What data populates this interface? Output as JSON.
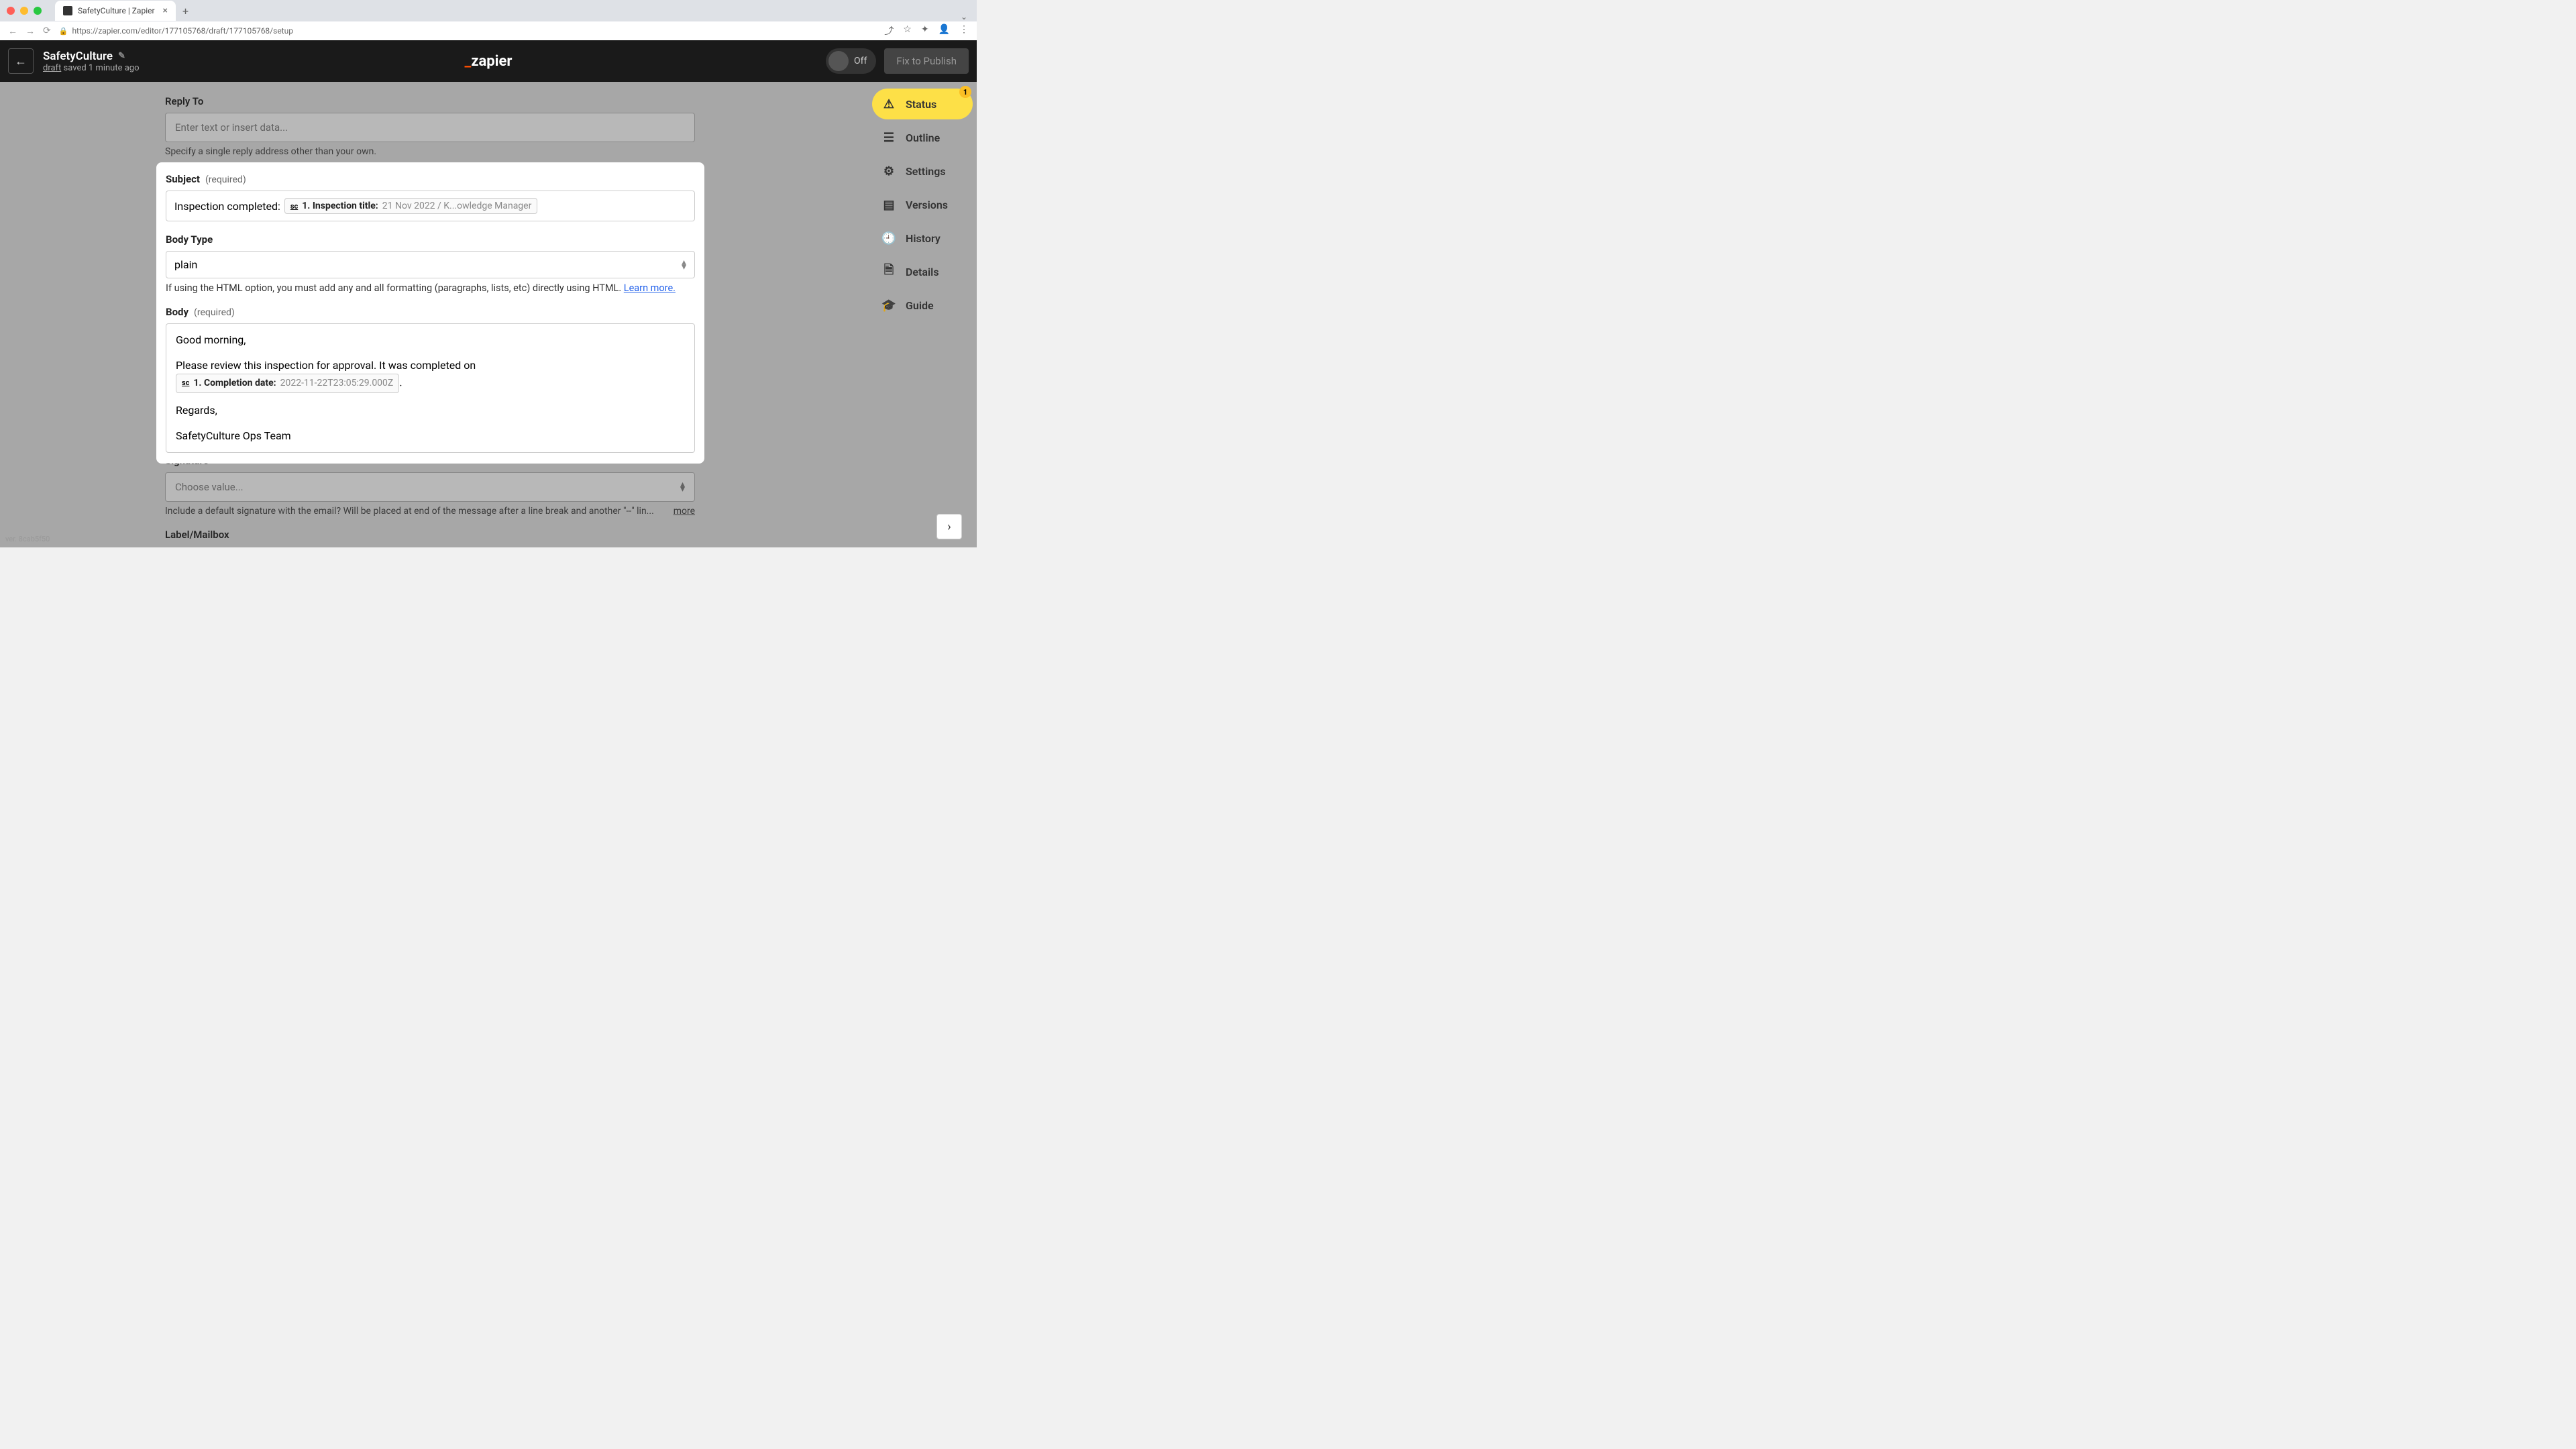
{
  "browser": {
    "tab_title": "SafetyCulture | Zapier",
    "url": "https://zapier.com/editor/177105768/draft/177105768/setup"
  },
  "header": {
    "title": "SafetyCulture",
    "draft_label": "draft",
    "saved_text": " saved 1 minute ago",
    "logo_accent": "_",
    "logo_text": "zapier",
    "toggle_label": "Off",
    "fix_button": "Fix to Publish"
  },
  "bg_form": {
    "reply_to_label": "Reply To",
    "reply_to_placeholder": "Enter text or insert data...",
    "reply_to_help": "Specify a single reply address other than your own.",
    "signature_label": "Signature",
    "signature_placeholder": "Choose value...",
    "signature_help": "Include a default signature with the email? Will be placed at end of the message after a line break and another \"--\" lin...",
    "signature_more": "more",
    "label_mailbox_label": "Label/Mailbox"
  },
  "rail": {
    "status": "Status",
    "status_badge": "1",
    "outline": "Outline",
    "settings": "Settings",
    "versions": "Versions",
    "history": "History",
    "details": "Details",
    "guide": "Guide"
  },
  "panel": {
    "subject_label": "Subject",
    "required": "(required)",
    "subject_prefix": "Inspection completed:",
    "subject_pill_label": "1. Inspection title:",
    "subject_pill_value": "21 Nov 2022 / K...owledge Manager",
    "body_type_label": "Body Type",
    "body_type_value": "plain",
    "body_type_help_text": "If using the HTML option, you must add any and all formatting (paragraphs, lists, etc) directly using HTML. ",
    "body_type_help_link": "Learn more.",
    "body_label": "Body",
    "body_line1": "Good morning,",
    "body_line2_pre": "Please review this inspection for approval. It was completed on ",
    "body_pill_label": "1. Completion date:",
    "body_pill_value": "2022-11-22T23:05:29.000Z",
    "body_line2_post": ".",
    "body_line3": "Regards,",
    "body_line4": "SafetyCulture Ops Team"
  },
  "footer": {
    "ver": "ver. 8cab5f50"
  }
}
